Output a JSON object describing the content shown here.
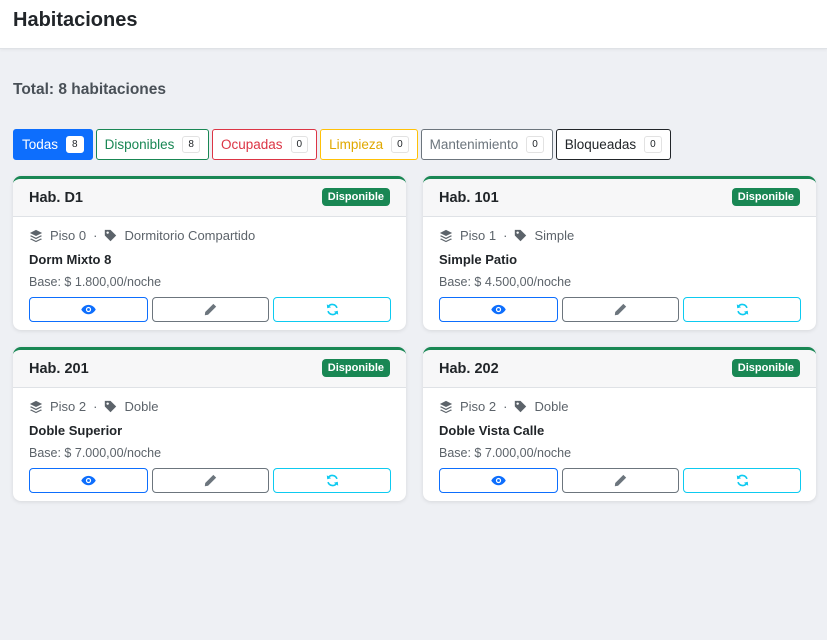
{
  "header": {
    "title": "Habitaciones"
  },
  "summary": {
    "total": "Total: 8 habitaciones"
  },
  "filters": [
    {
      "label": "Todas",
      "count": "8"
    },
    {
      "label": "Disponibles",
      "count": "8"
    },
    {
      "label": "Ocupadas",
      "count": "0"
    },
    {
      "label": "Limpieza",
      "count": "0"
    },
    {
      "label": "Mantenimiento",
      "count": "0"
    },
    {
      "label": "Bloqueadas",
      "count": "0"
    }
  ],
  "rooms": [
    {
      "title": "Hab. D1",
      "status": "Disponible",
      "floor": "Piso 0",
      "type": "Dormitorio Compartido",
      "name": "Dorm Mixto 8",
      "price": "Base: $ 1.800,00/noche"
    },
    {
      "title": "Hab. 101",
      "status": "Disponible",
      "floor": "Piso 1",
      "type": "Simple",
      "name": "Simple Patio",
      "price": "Base: $ 4.500,00/noche"
    },
    {
      "title": "Hab. 201",
      "status": "Disponible",
      "floor": "Piso 2",
      "type": "Doble",
      "name": "Doble Superior",
      "price": "Base: $ 7.000,00/noche"
    },
    {
      "title": "Hab. 202",
      "status": "Disponible",
      "floor": "Piso 2",
      "type": "Doble",
      "name": "Doble Vista Calle",
      "price": "Base: $ 7.000,00/noche"
    }
  ],
  "meta": {
    "separator": "·"
  },
  "colors": {
    "primary": "#0d6efd",
    "success": "#198754",
    "danger": "#dc3545",
    "warning": "#ffc107",
    "secondary": "#6c757d",
    "info": "#0dcaf0",
    "dark": "#212529"
  },
  "icons": {
    "floor": "layers-icon",
    "type": "tag-icon",
    "view": "eye-icon",
    "edit": "pencil-icon",
    "sync": "refresh-icon"
  }
}
